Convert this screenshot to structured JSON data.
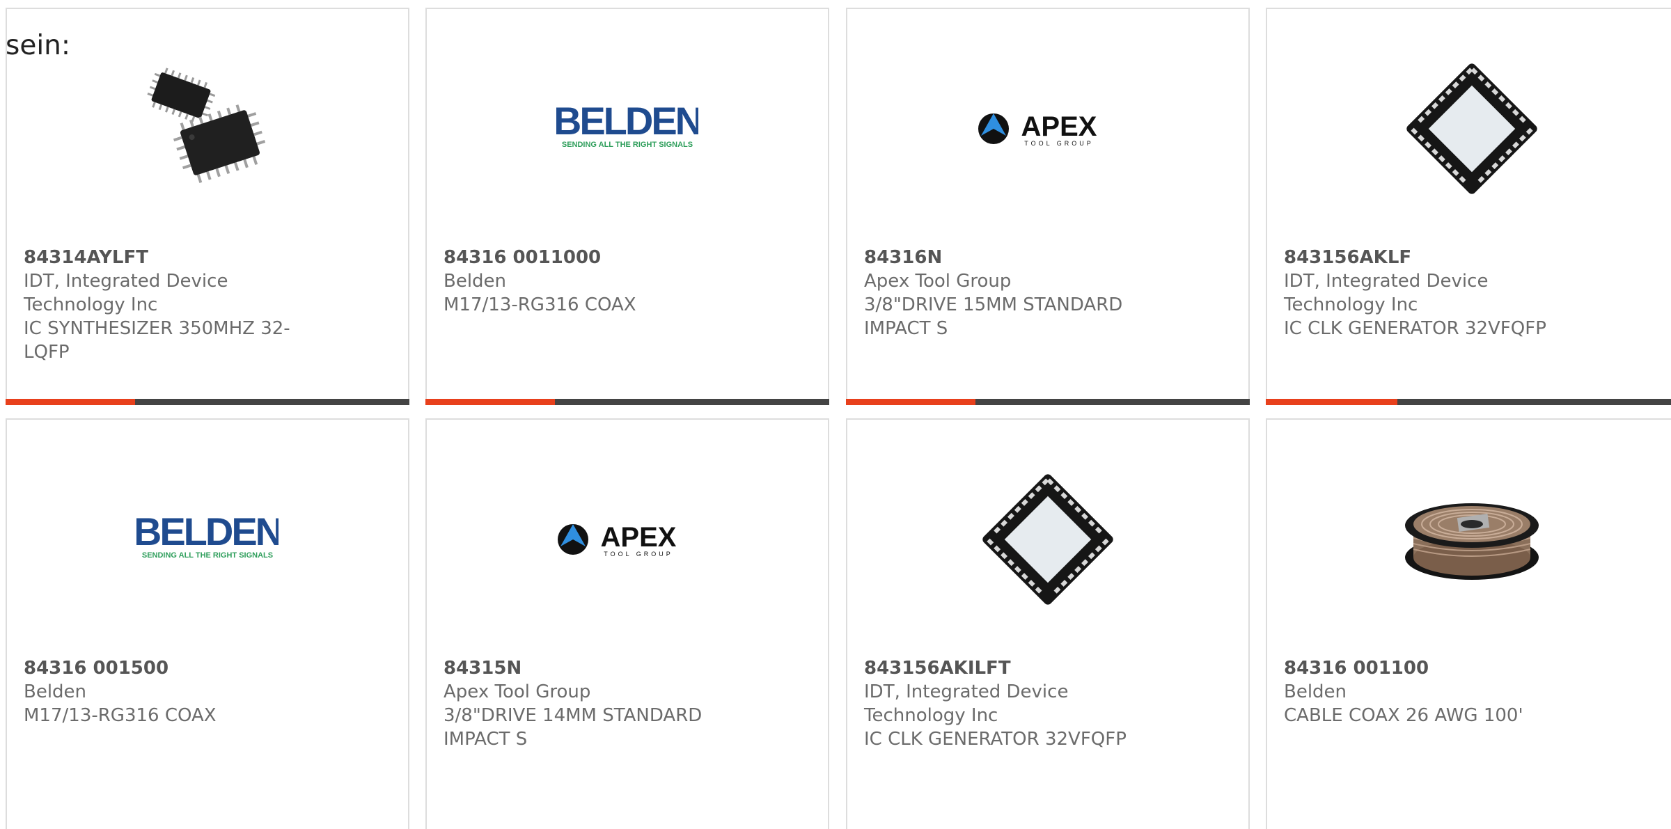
{
  "heading": "sein:",
  "colors": {
    "accent": "#e8401c",
    "bar": "#444444",
    "belden_blue": "#1f4b8f",
    "belden_green": "#2e9e5b"
  },
  "cards": [
    {
      "part_number": "84314AYLFT",
      "manufacturer_lines": [
        "IDT, Integrated Device",
        "Technology Inc"
      ],
      "description_lines": [
        "IC SYNTHESIZER 350MHZ 32-",
        "LQFP"
      ],
      "image": "lqfp-chip-image"
    },
    {
      "part_number": "84316 0011000",
      "manufacturer_lines": [
        "Belden"
      ],
      "description_lines": [
        "M17/13-RG316 COAX"
      ],
      "image": "belden-logo",
      "logo_text": "BELDEN",
      "logo_tagline": "SENDING ALL THE RIGHT SIGNALS"
    },
    {
      "part_number": "84316N",
      "manufacturer_lines": [
        "Apex Tool Group"
      ],
      "description_lines": [
        "3/8\"DRIVE 15MM STANDARD",
        "IMPACT S"
      ],
      "image": "apex-logo",
      "logo_text": "APEX",
      "logo_tagline": "TOOL GROUP"
    },
    {
      "part_number": "843156AKLF",
      "manufacturer_lines": [
        "IDT, Integrated Device",
        "Technology Inc"
      ],
      "description_lines": [
        "IC CLK GENERATOR 32VFQFP"
      ],
      "image": "qfn-chip-image"
    },
    {
      "part_number": "84316 001500",
      "manufacturer_lines": [
        "Belden"
      ],
      "description_lines": [
        "M17/13-RG316 COAX"
      ],
      "image": "belden-logo",
      "logo_text": "BELDEN",
      "logo_tagline": "SENDING ALL THE RIGHT SIGNALS"
    },
    {
      "part_number": "84315N",
      "manufacturer_lines": [
        "Apex Tool Group"
      ],
      "description_lines": [
        "3/8\"DRIVE 14MM STANDARD",
        "IMPACT S"
      ],
      "image": "apex-logo",
      "logo_text": "APEX",
      "logo_tagline": "TOOL GROUP"
    },
    {
      "part_number": "843156AKILFT",
      "manufacturer_lines": [
        "IDT, Integrated Device",
        "Technology Inc"
      ],
      "description_lines": [
        "IC CLK GENERATOR 32VFQFP"
      ],
      "image": "qfn-chip-image"
    },
    {
      "part_number": "84316 001100",
      "manufacturer_lines": [
        "Belden"
      ],
      "description_lines": [
        "CABLE COAX 26 AWG 100'"
      ],
      "image": "cable-spool-image"
    }
  ]
}
